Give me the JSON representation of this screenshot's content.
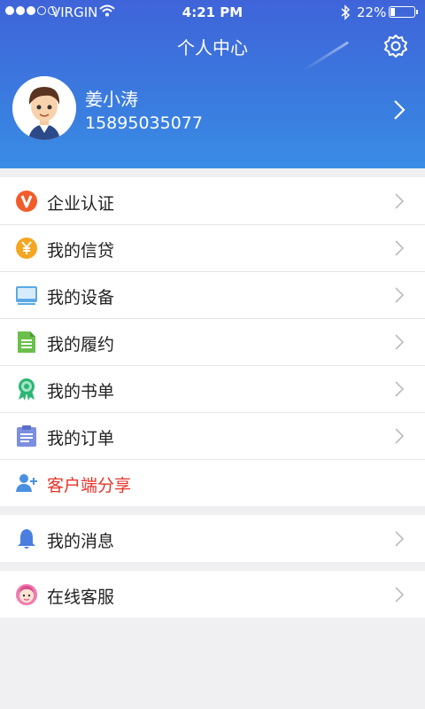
{
  "status_bar": {
    "carrier": "VIRGIN",
    "time": "4:21 PM",
    "battery": "22%",
    "battery_level": 0.22
  },
  "header": {
    "title": "个人中心",
    "settings_icon": "gear-icon"
  },
  "profile": {
    "name": "姜小涛",
    "phone": "15895035077"
  },
  "menu": [
    {
      "label": "企业认证",
      "icon": "verified-v-icon",
      "color": "#f25c2b"
    },
    {
      "label": "我的信贷",
      "icon": "yuan-coin-icon",
      "color": "#f5a623"
    },
    {
      "label": "我的设备",
      "icon": "monitor-icon",
      "color": "#5aa9e6"
    },
    {
      "label": "我的履约",
      "icon": "document-icon",
      "color": "#6bc04b"
    },
    {
      "label": "我的书单",
      "icon": "award-ribbon-icon",
      "color": "#2bb673"
    },
    {
      "label": "我的订单",
      "icon": "clipboard-icon",
      "color": "#7b8fe0"
    },
    {
      "label": "客户端分享",
      "icon": "add-user-icon",
      "color": "#4a90e2"
    }
  ],
  "messages": {
    "label": "我的消息",
    "icon": "bell-icon",
    "color": "#4a7fe0"
  },
  "support": {
    "label": "在线客服",
    "icon": "support-agent-icon",
    "color": "#f07bb0"
  }
}
